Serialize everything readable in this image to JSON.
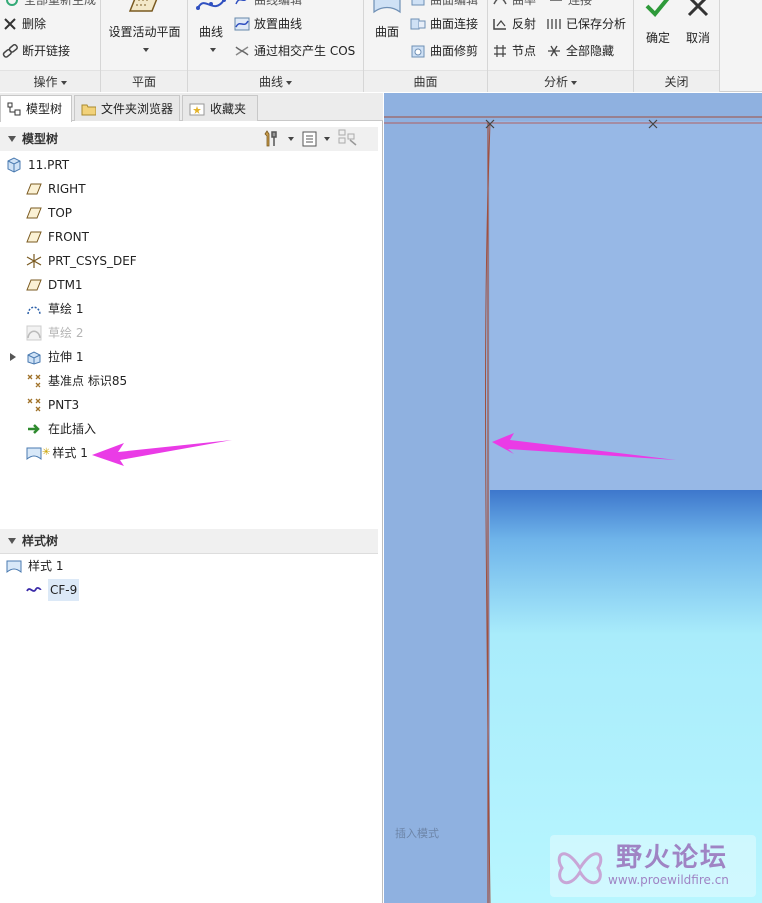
{
  "ribbon": {
    "operations": {
      "top_partial": "全部重新生成",
      "delete": "删除",
      "break_link": "断开链接",
      "label": "操作"
    },
    "plane": {
      "set_active_plane": "设置活动平面",
      "label": "平面"
    },
    "curve": {
      "curve": "曲线",
      "top_partial": "曲线编辑",
      "place_curve": "放置曲线",
      "cos_through": "通过相交产生 COS",
      "label": "曲线"
    },
    "surface": {
      "surface": "曲面",
      "top_partial": "曲面编辑",
      "surface_connect": "曲面连接",
      "surface_trim": "曲面修剪",
      "label": "曲面"
    },
    "analysis": {
      "top_partial_1": "曲率",
      "top_partial_2": "连接",
      "reflection": "反射",
      "saved_analysis": "已保存分析",
      "node": "节点",
      "hide_all": "全部隐藏",
      "label": "分析"
    },
    "close": {
      "ok": "确定",
      "cancel": "取消",
      "label": "关闭"
    }
  },
  "left_panel": {
    "tabs": [
      "模型树",
      "文件夹浏览器",
      "收藏夹"
    ],
    "model_tree_title": "模型树",
    "model_tree_items": [
      "11.PRT",
      "RIGHT",
      "TOP",
      "FRONT",
      "PRT_CSYS_DEF",
      "DTM1",
      "草绘 1",
      "草绘 2",
      "拉伸 1",
      "基准点 标识85",
      "PNT3",
      "在此插入",
      "样式 1"
    ],
    "style_tree_title": "样式树",
    "style_tree_items": [
      "样式 1",
      "CF-9"
    ]
  },
  "viewport": {
    "status_text": "插入模式",
    "watermark_title": "野火论坛",
    "watermark_url": "www.proewildfire.cn"
  },
  "colors": {
    "viewport_bg": "#8fb1e0",
    "arrow": "#ea3be6",
    "curve": "#a0503f"
  }
}
